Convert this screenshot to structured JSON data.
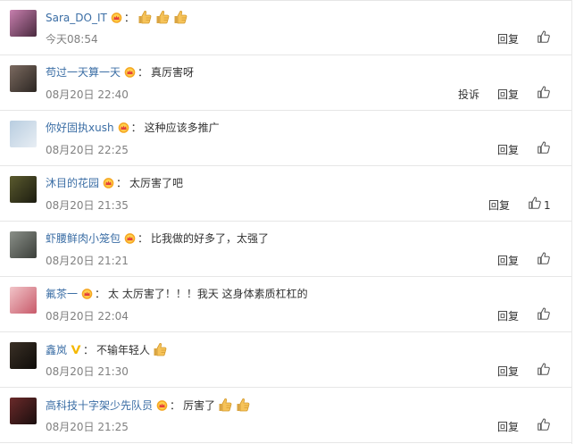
{
  "comments": [
    {
      "username": "Sara_DO_IT",
      "vip": "crown",
      "text": "",
      "emoji_thumbs": 3,
      "time": "今天08:54",
      "actions": [
        "回复"
      ],
      "like_count": "",
      "avatar_colors": [
        "#c77fae",
        "#4a2a3f"
      ]
    },
    {
      "username": "苟过一天算一天",
      "vip": "crown",
      "text": "真厉害呀",
      "emoji_thumbs": 0,
      "time": "08月20日 22:40",
      "actions": [
        "投诉",
        "回复"
      ],
      "like_count": "",
      "avatar_colors": [
        "#7b6a60",
        "#2c2622"
      ]
    },
    {
      "username": "你好固执xush",
      "vip": "crown",
      "text": "这种应该多推广",
      "emoji_thumbs": 0,
      "time": "08月20日 22:25",
      "actions": [
        "回复"
      ],
      "like_count": "",
      "avatar_colors": [
        "#b8cde0",
        "#e8eef4"
      ]
    },
    {
      "username": "沐目的花园",
      "vip": "crown",
      "text": "太厉害了吧",
      "emoji_thumbs": 0,
      "time": "08月20日 21:35",
      "actions": [
        "回复"
      ],
      "like_count": "1",
      "avatar_colors": [
        "#5a5a2e",
        "#1c1c10"
      ]
    },
    {
      "username": "虾腰鲜肉小笼包",
      "vip": "crown",
      "text": "比我做的好多了，太强了",
      "emoji_thumbs": 0,
      "time": "08月20日 21:21",
      "actions": [
        "回复"
      ],
      "like_count": "",
      "avatar_colors": [
        "#8a8f88",
        "#3b3f3a"
      ]
    },
    {
      "username": "氟茶一",
      "vip": "crown",
      "text": "太 太厉害了！！！我天 这身体素质杠杠的",
      "emoji_thumbs": 0,
      "time": "08月20日 22:04",
      "actions": [
        "回复"
      ],
      "like_count": "",
      "avatar_colors": [
        "#f1c4c8",
        "#c85a6a"
      ]
    },
    {
      "username": "鑫岚",
      "vip": "v",
      "text": "不输年轻人",
      "emoji_thumbs": 1,
      "time": "08月20日 21:30",
      "actions": [
        "回复"
      ],
      "like_count": "",
      "avatar_colors": [
        "#3a3026",
        "#0f0c09"
      ]
    },
    {
      "username": "高科技十字架少先队员",
      "vip": "crown",
      "text": "厉害了",
      "emoji_thumbs": 2,
      "time": "08月20日 21:25",
      "actions": [
        "回复"
      ],
      "like_count": "",
      "avatar_colors": [
        "#6a2a2a",
        "#1a0e0e"
      ]
    }
  ],
  "icons": {
    "like": "thumbs-up-outline-icon",
    "vip_crown": "crown-badge-icon",
    "vip_v": "verified-v-icon",
    "emoji": "thumbs-up-emoji"
  },
  "colors": {
    "username": "#3b6ea5",
    "time": "#808080",
    "separator": "#e6e6e6"
  },
  "colon": "："
}
